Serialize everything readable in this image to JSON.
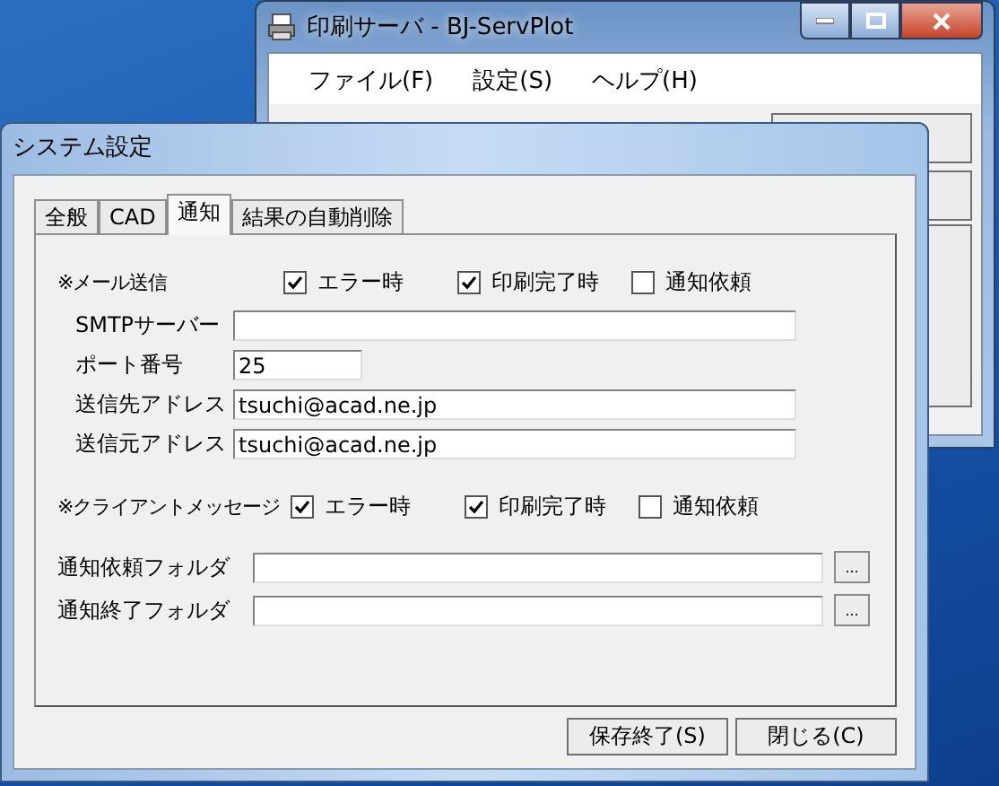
{
  "background_window": {
    "title": "印刷サーバ - BJ-ServPlot",
    "menu": [
      "ファイル(F)",
      "設定(S)",
      "ヘルプ(H)"
    ]
  },
  "dialog": {
    "title": "システム設定",
    "tabs": [
      {
        "label": "全般",
        "selected": false
      },
      {
        "label": "CAD",
        "selected": false
      },
      {
        "label": "通知",
        "selected": true
      },
      {
        "label": "結果の自動削除",
        "selected": false
      }
    ],
    "mail": {
      "heading": "※メール送信",
      "options": [
        {
          "label": "エラー時",
          "checked": true
        },
        {
          "label": "印刷完了時",
          "checked": true
        },
        {
          "label": "通知依頼",
          "checked": false
        }
      ],
      "fields": [
        {
          "label": "SMTPサーバー",
          "kind": "wide"
        },
        {
          "label": "ポート番号",
          "value": "25",
          "kind": "short"
        },
        {
          "label": "送信先アドレス",
          "value": "tsuchi@acad.ne.jp",
          "kind": "wide"
        },
        {
          "label": "送信元アドレス",
          "value": "tsuchi@acad.ne.jp",
          "kind": "wide"
        }
      ]
    },
    "client": {
      "heading": "※クライアントメッセージ",
      "options": [
        {
          "label": "エラー時",
          "checked": true
        },
        {
          "label": "印刷完了時",
          "checked": true
        },
        {
          "label": "通知依頼",
          "checked": false
        }
      ]
    },
    "folders": [
      {
        "label": "通知依頼フォルダ",
        "browse": "..."
      },
      {
        "label": "通知終了フォルダ",
        "browse": "..."
      }
    ],
    "buttons": [
      "保存終了(S)",
      "閉じる(C)"
    ]
  }
}
